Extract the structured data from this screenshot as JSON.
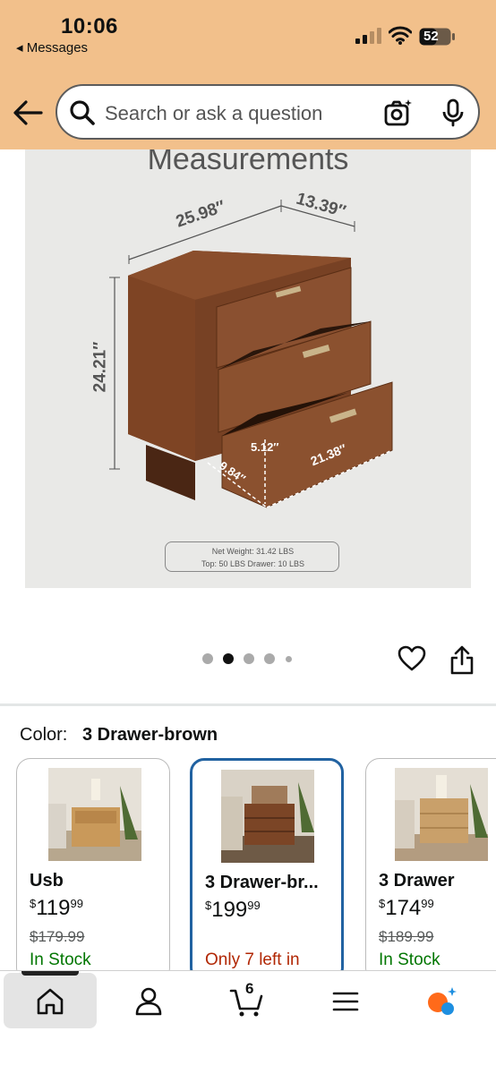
{
  "status_bar": {
    "time": "10:06",
    "back_label": "◂ Messages",
    "battery": "52"
  },
  "search": {
    "placeholder": "Search or ask a question"
  },
  "product_image": {
    "title": "Measurements",
    "dims": {
      "width": "25.98″",
      "depth": "13.39″",
      "height": "24.21″",
      "drawer_height": "5.12″",
      "drawer_width": "21.38″",
      "drawer_depth": "9.84″"
    },
    "net_weight": "Net Weight: 31.42 LBS",
    "load": "Top: 50 LBS    Drawer: 10 LBS"
  },
  "carousel": {
    "dot_count": 5,
    "active_index": 1
  },
  "color": {
    "label": "Color:",
    "value": "3 Drawer-brown"
  },
  "variants": [
    {
      "name": "Usb",
      "currency": "$",
      "price_whole": "119",
      "price_frac": "99",
      "old_price": "$179.99",
      "stock": "In Stock",
      "selected": false
    },
    {
      "name": "3 Drawer-br...",
      "currency": "$",
      "price_whole": "199",
      "price_frac": "99",
      "old_price": "",
      "stock": "Only 7 left in",
      "selected": true
    },
    {
      "name": "3 Drawer",
      "currency": "$",
      "price_whole": "174",
      "price_frac": "99",
      "old_price": "$189.99",
      "stock": "In Stock",
      "selected": false
    }
  ],
  "bottom_nav": {
    "cart_count": "6",
    "active": "home"
  },
  "colors": {
    "header": "#f2c08b",
    "accent_blue": "#2162a1",
    "stock_green": "#007600",
    "stock_red": "#b12704"
  }
}
